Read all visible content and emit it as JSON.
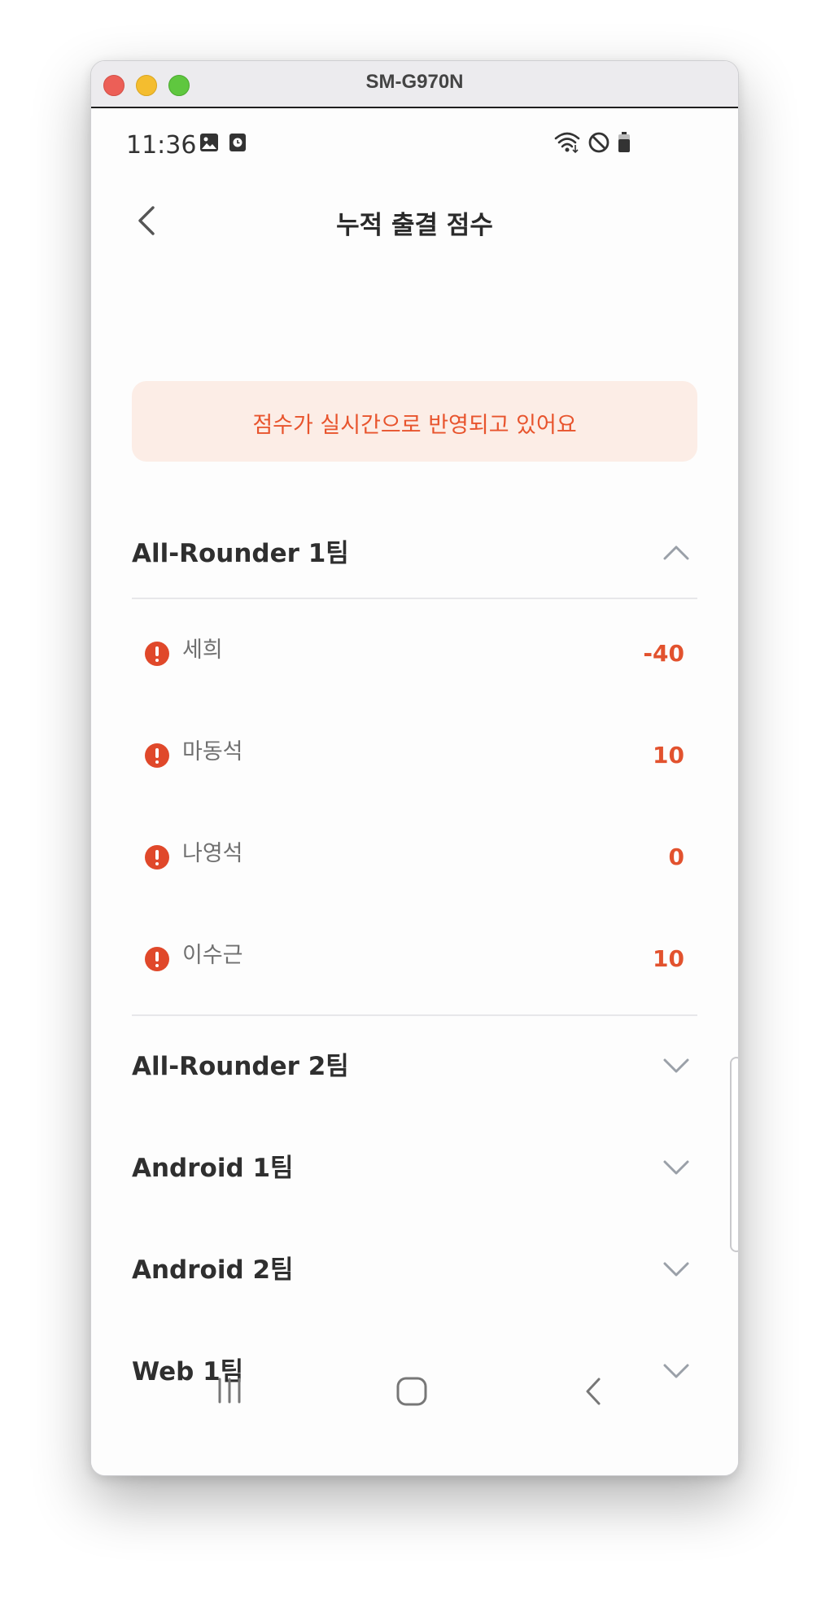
{
  "window": {
    "title": "SM-G970N"
  },
  "statusbar": {
    "time": "11:36",
    "icons": [
      "image-icon",
      "alarm-app-icon",
      "wifi-icon",
      "do-not-disturb-icon",
      "battery-icon"
    ]
  },
  "appbar": {
    "title": "누적 출결 점수",
    "back_icon": "chevron-left-icon"
  },
  "notice": {
    "text": "점수가 실시간으로 반영되고 있어요"
  },
  "groups": [
    {
      "title": "All-Rounder 1팀",
      "expanded": true,
      "members": [
        {
          "name": "세희",
          "score": "-40"
        },
        {
          "name": "마동석",
          "score": "10"
        },
        {
          "name": "나영석",
          "score": "0"
        },
        {
          "name": "이수근",
          "score": "10"
        }
      ]
    },
    {
      "title": "All-Rounder 2팀",
      "expanded": false
    },
    {
      "title": "Android 1팀",
      "expanded": false
    },
    {
      "title": "Android 2팀",
      "expanded": false
    },
    {
      "title": "Web 1팀",
      "expanded": false
    }
  ],
  "navbar": {
    "icons": [
      "recent-apps-icon",
      "home-icon",
      "back-icon"
    ]
  },
  "colors": {
    "accent": "#e2522e",
    "notice_bg": "#fcede6",
    "divider": "#e7e7ea"
  }
}
